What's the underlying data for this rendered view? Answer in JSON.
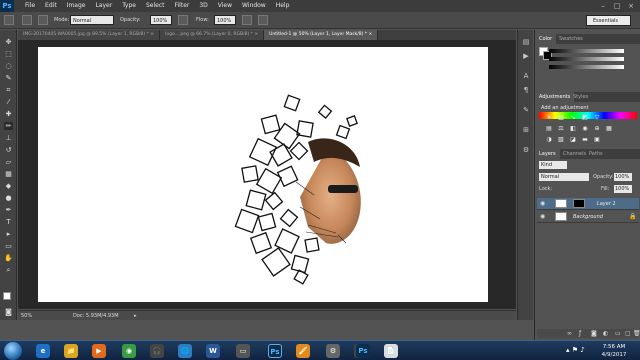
{
  "app": {
    "logo": "Ps"
  },
  "menu": [
    "File",
    "Edit",
    "Image",
    "Layer",
    "Type",
    "Select",
    "Filter",
    "3D",
    "View",
    "Window",
    "Help"
  ],
  "window_controls": [
    "–",
    "□",
    "×"
  ],
  "options_bar": {
    "mode_label": "Mode:",
    "mode_value": "Normal",
    "opacity_label": "Opacity:",
    "opacity_value": "100%",
    "flow_label": "Flow:",
    "flow_value": "100%",
    "workspace": "Essentials"
  },
  "doc_tabs": [
    {
      "label": "IMG-20170405-WA0005.jpg @ 89.5% (Layer 1, RGB/8) *",
      "close": "×"
    },
    {
      "label": "logo....peg @ 66.7% (Layer 0, RGB/8) *",
      "close": "×"
    },
    {
      "label": "Untitled-1 @ 50% (Layer 1, Layer Mask/8) *",
      "close": "×"
    }
  ],
  "status": {
    "zoom": "50%",
    "doc": "Doc: 5.93M/4.93M"
  },
  "panels": {
    "color_tab": "Color",
    "swatches_tab": "Swatches",
    "adjustments_tab": "Adjustments",
    "styles_tab": "Styles",
    "add_adjustment": "Add an adjustment",
    "layers_tab": "Layers",
    "channels_tab": "Channels",
    "paths_tab": "Paths",
    "kind_label": "Kind",
    "blend_mode": "Normal",
    "opacity_label": "Opacity:",
    "opacity_value": "100%",
    "lock_label": "Lock:",
    "fill_label": "Fill:",
    "fill_value": "100%",
    "layers": [
      {
        "name": "Layer 1",
        "selected": true
      },
      {
        "name": "Background",
        "selected": false
      }
    ]
  },
  "taskbar": {
    "time": "7:56 AM",
    "date": "4/9/2017",
    "apps": [
      "e",
      "📁",
      "▶",
      "◉",
      "🎧",
      "🌐",
      "W",
      "▭",
      "Ps",
      "🖌",
      "⚙",
      "🔊",
      "Ps",
      "📄"
    ]
  },
  "colors": {
    "accent": "#4fb3ff",
    "selection": "#4e6b8a"
  }
}
